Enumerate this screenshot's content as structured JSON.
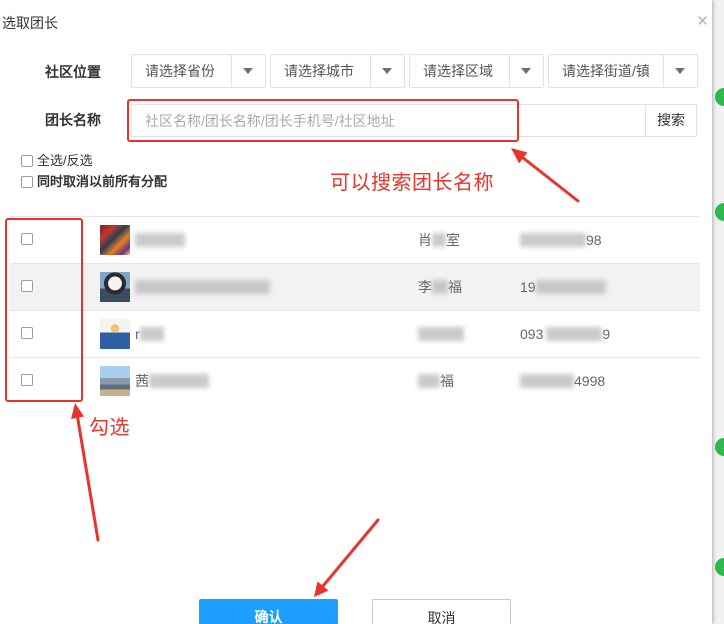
{
  "dialog": {
    "title": "选取团长",
    "close_label": "×"
  },
  "filters": {
    "location_label": "社区位置",
    "selects": [
      {
        "placeholder": "请选择省份"
      },
      {
        "placeholder": "请选择城市"
      },
      {
        "placeholder": "请选择区域"
      },
      {
        "placeholder": "请选择街道/镇"
      }
    ],
    "leader_name_label": "团长名称",
    "search_placeholder": "社区名称/团长名称/团长手机号/社区地址",
    "search_button": "搜索"
  },
  "options": {
    "select_all_label": "全选/反选",
    "select_all_checked": false,
    "clear_previous_label": "同时取消以前所有分配",
    "clear_previous_checked": false
  },
  "leaders": [
    {
      "checked": false,
      "contact_a": "肖",
      "contact_b": "室",
      "phone_b": "98"
    },
    {
      "checked": false,
      "contact_a": "李",
      "contact_b": "福",
      "phone_a": "19"
    },
    {
      "checked": false,
      "name": "r",
      "phone_a": "093",
      "phone_b": "9"
    },
    {
      "checked": false,
      "name": "茜",
      "contact_b": "福",
      "phone_b": "4998"
    }
  ],
  "footer": {
    "confirm": "确认",
    "cancel": "取消"
  },
  "annotations": {
    "search_hint": "可以搜索团长名称",
    "select_hint": "勾选"
  },
  "colors": {
    "primary_button": "#1E9FFF",
    "annotation_red": "#E8352B",
    "row_highlight": "#F2F2F2",
    "background_status_green": "#2DB84D"
  }
}
